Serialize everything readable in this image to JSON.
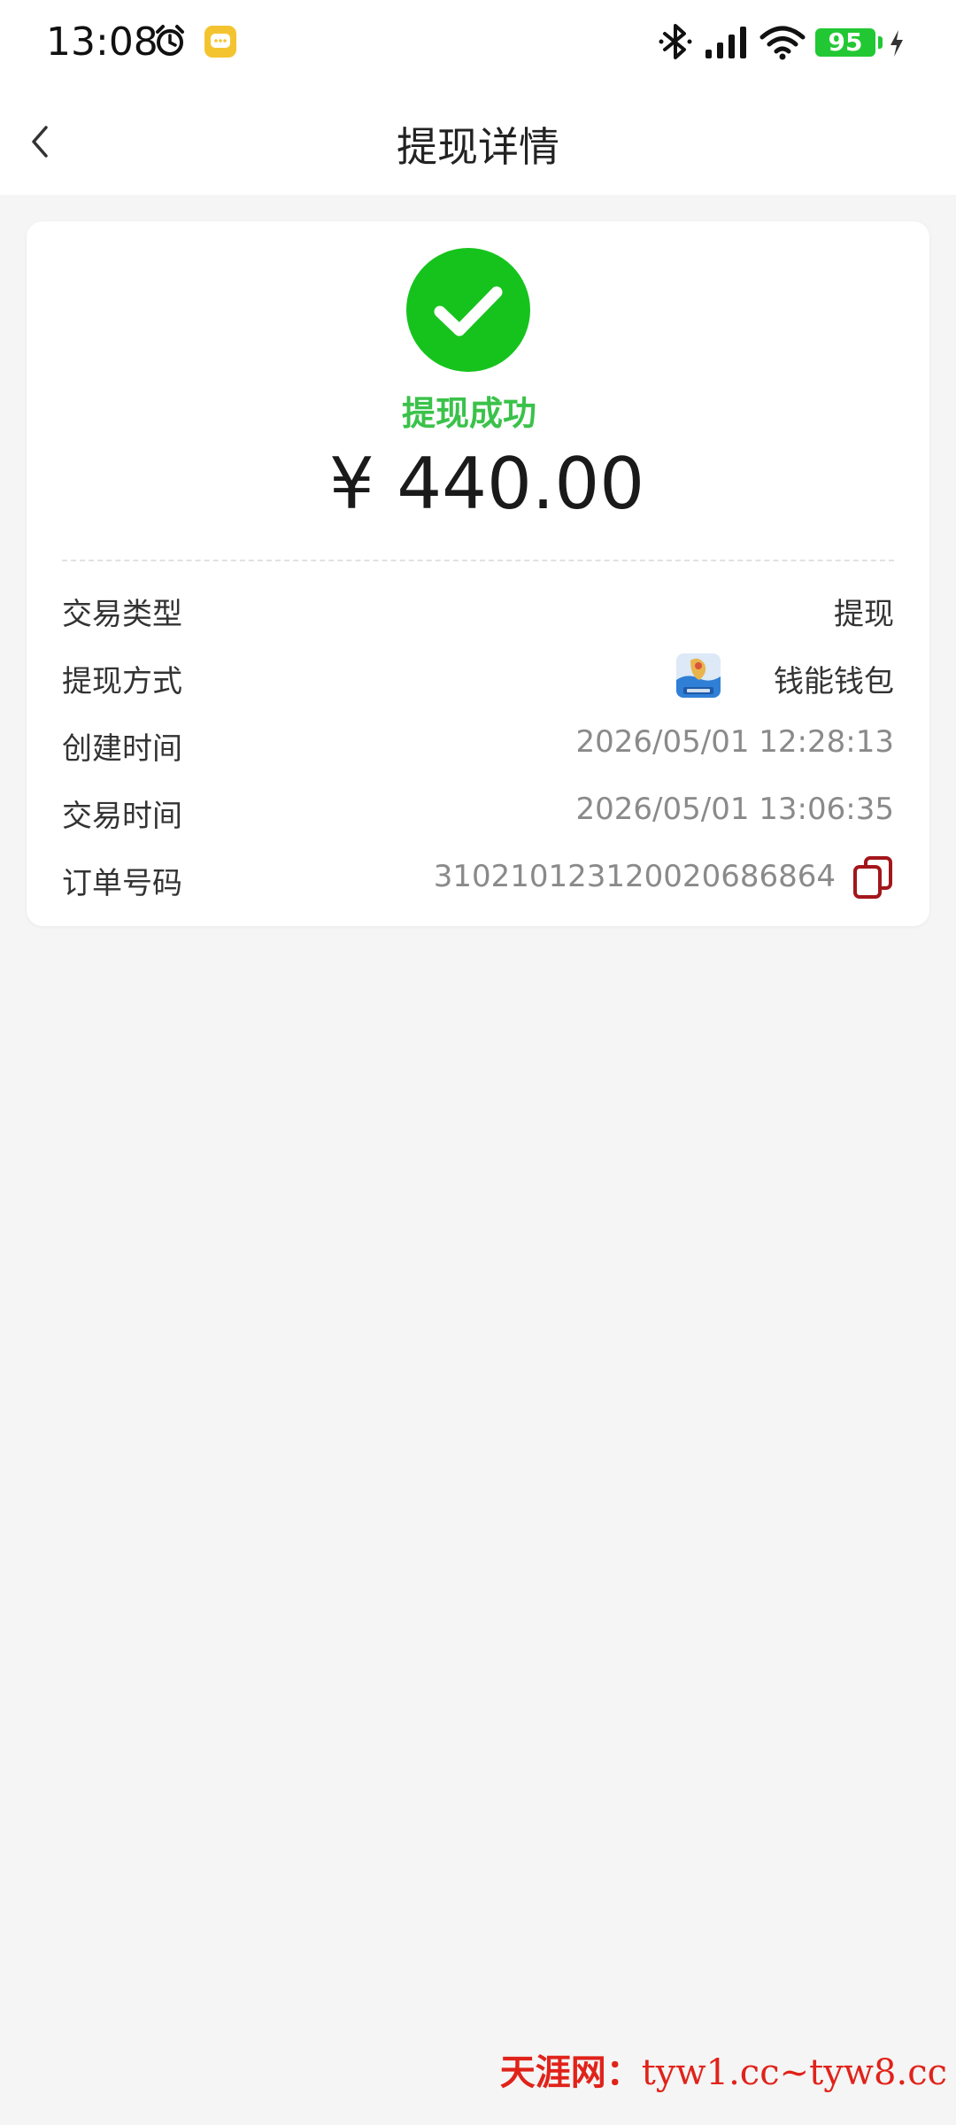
{
  "status_bar": {
    "time": "13:08",
    "battery": "95"
  },
  "header": {
    "title": "提现详情"
  },
  "result": {
    "status": "提现成功",
    "amount": "¥ 440.00",
    "status_color": "#3ac24a",
    "icon_color": "#16c31d"
  },
  "details": [
    {
      "label": "交易类型",
      "value": "提现"
    },
    {
      "label": "提现方式",
      "value": "钱能钱包"
    },
    {
      "label": "创建时间",
      "value": "2026/05/01 12:28:13"
    },
    {
      "label": "交易时间",
      "value": "2026/05/01 13:06:35"
    },
    {
      "label": "订单号码",
      "value": "3102101231200206868​64"
    }
  ],
  "watermark": {
    "site": "天涯网：",
    "domains": "tyw1.cc~tyw8.cc"
  }
}
